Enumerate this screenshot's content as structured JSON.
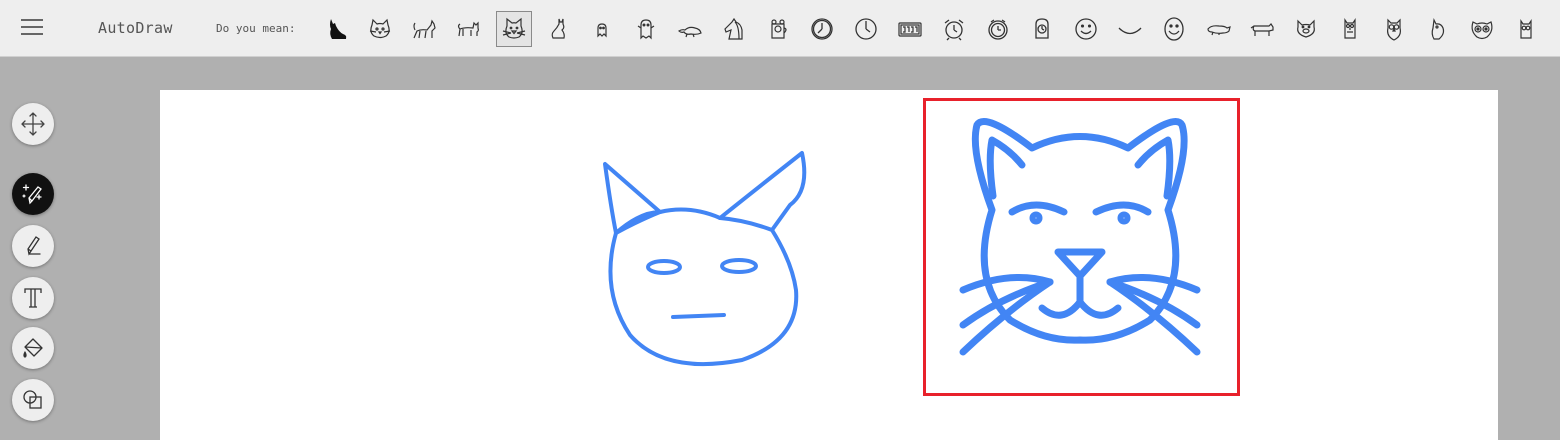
{
  "header": {
    "app_title": "AutoDraw",
    "suggest_label": "Do you mean:",
    "menu_icon": "hamburger-menu-icon"
  },
  "suggestions": [
    {
      "name": "black-cat-silhouette",
      "selected": false
    },
    {
      "name": "cat-face",
      "selected": false
    },
    {
      "name": "walking-cat",
      "selected": false
    },
    {
      "name": "cat-standing",
      "selected": false
    },
    {
      "name": "cat-face-outline",
      "selected": true
    },
    {
      "name": "sitting-cat",
      "selected": false
    },
    {
      "name": "small-ghost",
      "selected": false
    },
    {
      "name": "ghost",
      "selected": false
    },
    {
      "name": "platypus",
      "selected": false
    },
    {
      "name": "horse-head",
      "selected": false
    },
    {
      "name": "bear-mug",
      "selected": false
    },
    {
      "name": "clock",
      "selected": false
    },
    {
      "name": "wall-clock",
      "selected": false
    },
    {
      "name": "digital-clock",
      "selected": false
    },
    {
      "name": "alarm-clock",
      "selected": false
    },
    {
      "name": "alarm-clock-round",
      "selected": false
    },
    {
      "name": "desk-clock",
      "selected": false
    },
    {
      "name": "smiley-face",
      "selected": false
    },
    {
      "name": "smile",
      "selected": false
    },
    {
      "name": "smiley-face-oval",
      "selected": false
    },
    {
      "name": "pig",
      "selected": false
    },
    {
      "name": "pig-standing",
      "selected": false
    },
    {
      "name": "pig-face",
      "selected": false
    },
    {
      "name": "owl-small",
      "selected": false
    },
    {
      "name": "owl",
      "selected": false
    },
    {
      "name": "owl-simple",
      "selected": false
    },
    {
      "name": "owl-face",
      "selected": false
    },
    {
      "name": "owl-partial",
      "selected": false
    }
  ],
  "tools": [
    {
      "name": "select-tool",
      "icon": "move-arrows-icon",
      "active": false
    },
    {
      "name": "autodraw-tool",
      "icon": "magic-pencil-icon",
      "active": true
    },
    {
      "name": "draw-tool",
      "icon": "pencil-icon",
      "active": false
    },
    {
      "name": "type-tool",
      "icon": "text-t-icon",
      "active": false
    },
    {
      "name": "fill-tool",
      "icon": "paint-bucket-icon",
      "active": false
    },
    {
      "name": "shape-tool",
      "icon": "shapes-icon",
      "active": false
    }
  ],
  "colors": {
    "stroke": "#4285f4",
    "selection": "#e8212b",
    "toolbar_bg": "#eeeeee",
    "workspace_bg": "#b0b0b0",
    "active_tool_bg": "#111111"
  }
}
